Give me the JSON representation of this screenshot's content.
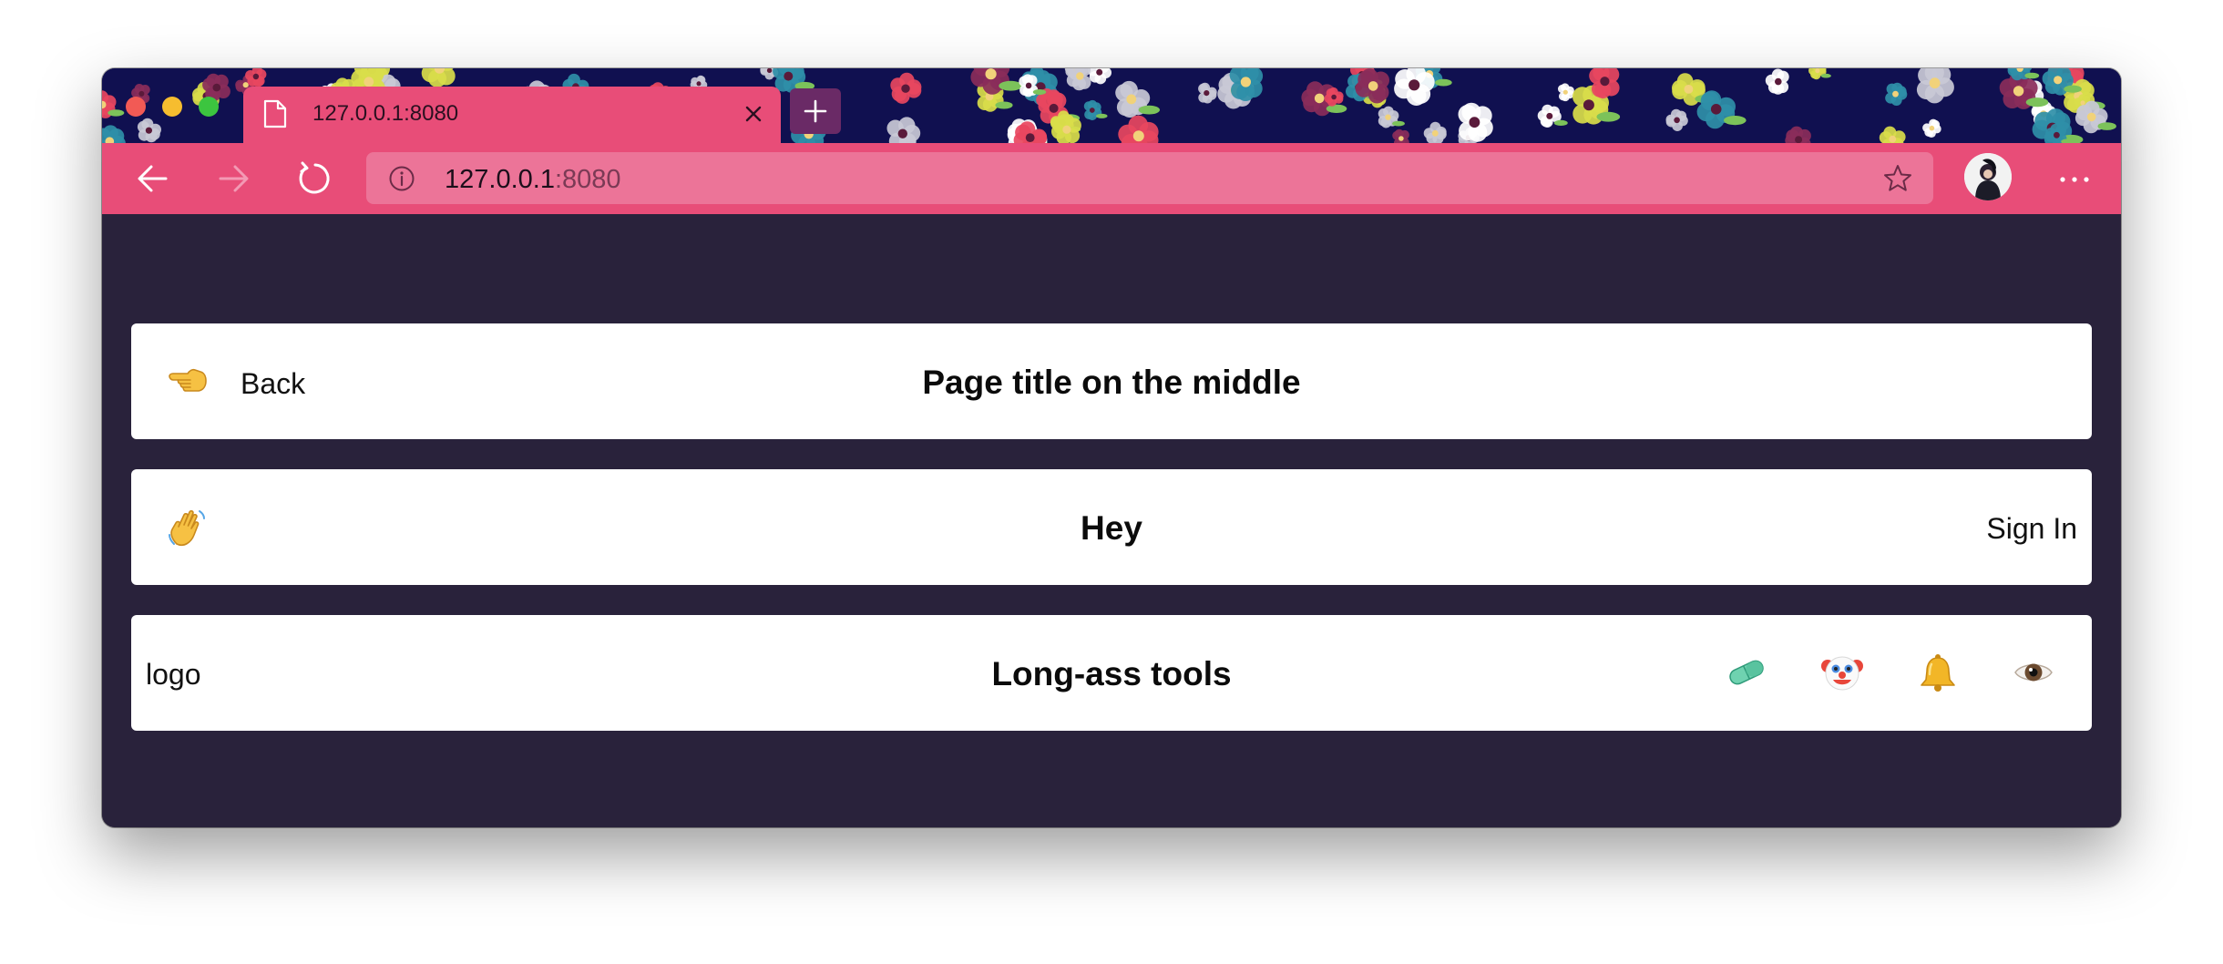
{
  "browser": {
    "tab": {
      "title": "127.0.0.1:8080",
      "icon": "page-icon"
    },
    "address_bar": {
      "host": "127.0.0.1",
      "port": ":8080"
    },
    "icons": {
      "back": "back-arrow-icon",
      "forward": "forward-arrow-icon",
      "reload": "reload-icon",
      "info": "info-icon",
      "favorite": "star-icon",
      "menu": "more-dots-icon",
      "new_tab": "plus-icon",
      "close_tab": "close-icon"
    },
    "colors": {
      "chrome_accent": "#e84d78",
      "address_bg": "#ec7498",
      "page_bg": "#29223b",
      "titlebar_bg": "#101050"
    }
  },
  "page": {
    "header_back": {
      "back_label": "Back",
      "back_icon": "pointing-left-hand-emoji",
      "title": "Page title on the middle"
    },
    "header_signin": {
      "wave_icon": "waving-hand-emoji",
      "title": "Hey",
      "signin_label": "Sign In"
    },
    "header_tools": {
      "logo_label": "logo",
      "title": "Long-ass tools",
      "tools": [
        {
          "icon": "pill-emoji"
        },
        {
          "icon": "clown-face-emoji"
        },
        {
          "icon": "bell-emoji"
        },
        {
          "icon": "eye-emoji"
        }
      ]
    }
  }
}
